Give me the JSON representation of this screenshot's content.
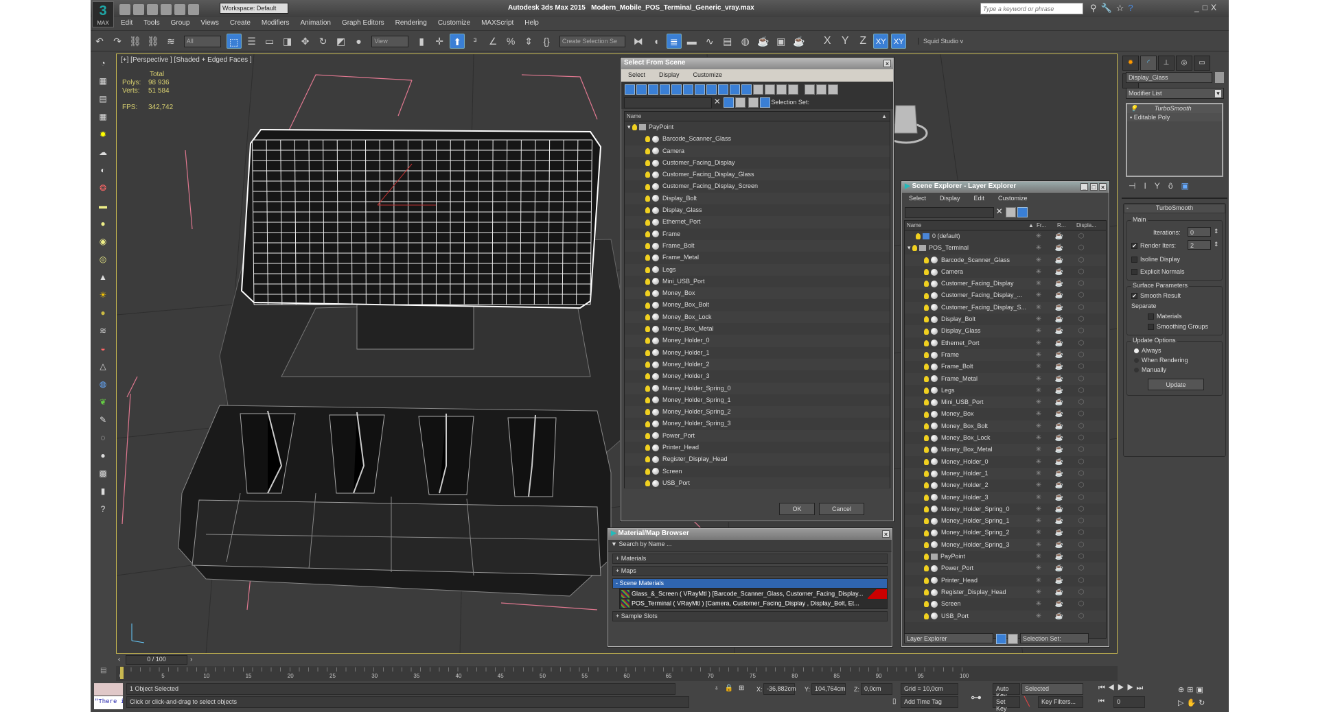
{
  "titlebar": {
    "app": "Autodesk 3ds Max  2015",
    "file": "Modern_Mobile_POS_Terminal_Generic_vray.max",
    "workspace": "Workspace: Default",
    "search_placeholder": "Type a keyword or phrase",
    "logo": "MAX"
  },
  "menu": [
    "Edit",
    "Tools",
    "Group",
    "Views",
    "Create",
    "Modifiers",
    "Animation",
    "Graph Editors",
    "Rendering",
    "Customize",
    "MAXScript",
    "Help"
  ],
  "toolbar": {
    "filter": "All",
    "refcoord": "View",
    "selection_set": "Create Selection Se",
    "axes": [
      "X",
      "Y",
      "Z",
      "XY",
      "XY"
    ],
    "plugin": "Squid Studio v",
    "icons": [
      "undo-icon",
      "redo-icon",
      "link-icon",
      "unlink-icon",
      "bind-spacewarp-icon"
    ]
  },
  "viewport": {
    "label": "[+] [Perspective ] [Shaded + Edged Faces ]",
    "stats": {
      "total": "Total",
      "polys_label": "Polys:",
      "polys": "98 936",
      "verts_label": "Verts:",
      "verts": "51 584",
      "fps_label": "FPS:",
      "fps": "342,742"
    }
  },
  "select_from_scene": {
    "title": "Select From Scene",
    "menu": [
      "Select",
      "Display",
      "Customize"
    ],
    "selection_set": "Selection Set:",
    "col_name": "Name",
    "root": "PayPoint",
    "items": [
      "Barcode_Scanner_Glass",
      "Camera",
      "Customer_Facing_Display",
      "Customer_Facing_Display_Glass",
      "Customer_Facing_Display_Screen",
      "Display_Bolt",
      "Display_Glass",
      "Ethernet_Port",
      "Frame",
      "Frame_Bolt",
      "Frame_Metal",
      "Legs",
      "Mini_USB_Port",
      "Money_Box",
      "Money_Box_Bolt",
      "Money_Box_Lock",
      "Money_Box_Metal",
      "Money_Holder_0",
      "Money_Holder_1",
      "Money_Holder_2",
      "Money_Holder_3",
      "Money_Holder_Spring_0",
      "Money_Holder_Spring_1",
      "Money_Holder_Spring_2",
      "Money_Holder_Spring_3",
      "Power_Port",
      "Printer_Head",
      "Register_Display_Head",
      "Screen",
      "USB_Port"
    ],
    "ok": "OK",
    "cancel": "Cancel"
  },
  "scene_explorer": {
    "title": "Scene Explorer - Layer Explorer",
    "menu": [
      "Select",
      "Display",
      "Edit",
      "Customize"
    ],
    "cols": [
      "Name",
      "Fr...",
      "R...",
      "Displa..."
    ],
    "layers": [
      "0 (default)",
      "POS_Terminal"
    ],
    "items": [
      "Barcode_Scanner_Glass",
      "Camera",
      "Customer_Facing_Display",
      "Customer_Facing_Display_...",
      "Customer_Facing_Display_S...",
      "Display_Bolt",
      "Display_Glass",
      "Ethernet_Port",
      "Frame",
      "Frame_Bolt",
      "Frame_Metal",
      "Legs",
      "Mini_USB_Port",
      "Money_Box",
      "Money_Box_Bolt",
      "Money_Box_Lock",
      "Money_Box_Metal",
      "Money_Holder_0",
      "Money_Holder_1",
      "Money_Holder_2",
      "Money_Holder_3",
      "Money_Holder_Spring_0",
      "Money_Holder_Spring_1",
      "Money_Holder_Spring_2",
      "Money_Holder_Spring_3",
      "PayPoint",
      "Power_Port",
      "Printer_Head",
      "Register_Display_Head",
      "Screen",
      "USB_Port"
    ],
    "footer_explorer": "Layer Explorer",
    "footer_selset": "Selection Set:"
  },
  "material_browser": {
    "title": "Material/Map Browser",
    "search": "Search by Name ...",
    "sections": [
      "+ Materials",
      "+ Maps",
      "- Scene Materials",
      "+ Sample Slots"
    ],
    "materials": [
      "Glass_&_Screen  ( VRayMtl ) [Barcode_Scanner_Glass, Customer_Facing_Display...",
      "POS_Terminal  ( VRayMtl ) [Camera, Customer_Facing_Display , Display_Bolt, Et..."
    ]
  },
  "command_panel": {
    "object_name": "Display_Glass",
    "modifier_list": "Modifier List",
    "stack": [
      "TurboSmooth",
      "Editable Poly"
    ],
    "rollout": "TurboSmooth",
    "main": "Main",
    "iterations_label": "Iterations:",
    "iterations": "0",
    "render_iters_label": "Render Iters:",
    "render_iters": "2",
    "isoline": "Isoline Display",
    "explicit": "Explicit Normals",
    "surface": "Surface Parameters",
    "smooth_result": "Smooth Result",
    "separate": "Separate",
    "materials": "Materials",
    "smoothing_groups": "Smoothing Groups",
    "update_options": "Update Options",
    "always": "Always",
    "when_rendering": "When Rendering",
    "manually": "Manually",
    "update": "Update"
  },
  "timeline": {
    "frame": "0 / 100",
    "ticks": [
      "0",
      "5",
      "10",
      "15",
      "20",
      "25",
      "30",
      "35",
      "40",
      "45",
      "50",
      "55",
      "60",
      "65",
      "70",
      "75",
      "80",
      "85",
      "90",
      "95",
      "100"
    ]
  },
  "status": {
    "selected": "1 Object Selected",
    "prompt": "Click or click-and-drag to select objects",
    "maxscript": "\"There is no",
    "x": "-36,882cm",
    "y": "104,764cm",
    "z": "0,0cm",
    "grid": "Grid = 10,0cm",
    "add_time_tag": "Add Time Tag",
    "auto_key": "Auto Key",
    "set_key": "Set Key",
    "key_mode": "Selected",
    "key_filters": "Key Filters...",
    "frame": "0",
    "x_label": "X:",
    "y_label": "Y:",
    "z_label": "Z:"
  }
}
